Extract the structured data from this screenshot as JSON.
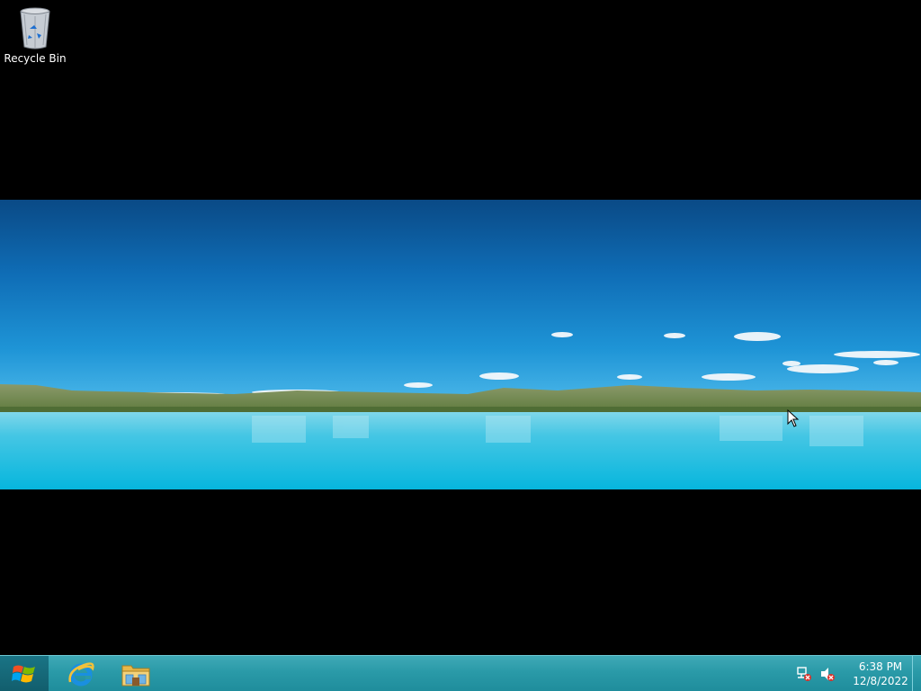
{
  "desktop": {
    "icons": [
      {
        "label": "Recycle Bin",
        "icon": "recycle-bin-icon"
      }
    ],
    "wallpaper": "lake-landscape"
  },
  "taskbar": {
    "start_icon": "windows-logo-icon",
    "pinned": [
      {
        "name": "Internet Explorer",
        "icon": "internet-explorer-icon"
      },
      {
        "name": "File Explorer",
        "icon": "file-explorer-icon"
      }
    ],
    "tray": {
      "icons": [
        "network-disconnected-icon",
        "volume-muted-icon"
      ],
      "time": "6:38 PM",
      "date": "12/8/2022"
    }
  },
  "colors": {
    "taskbar": "#2a9aa8",
    "desktop_background": "#000000",
    "sky": "#1183cc",
    "water": "#34c6e0"
  }
}
